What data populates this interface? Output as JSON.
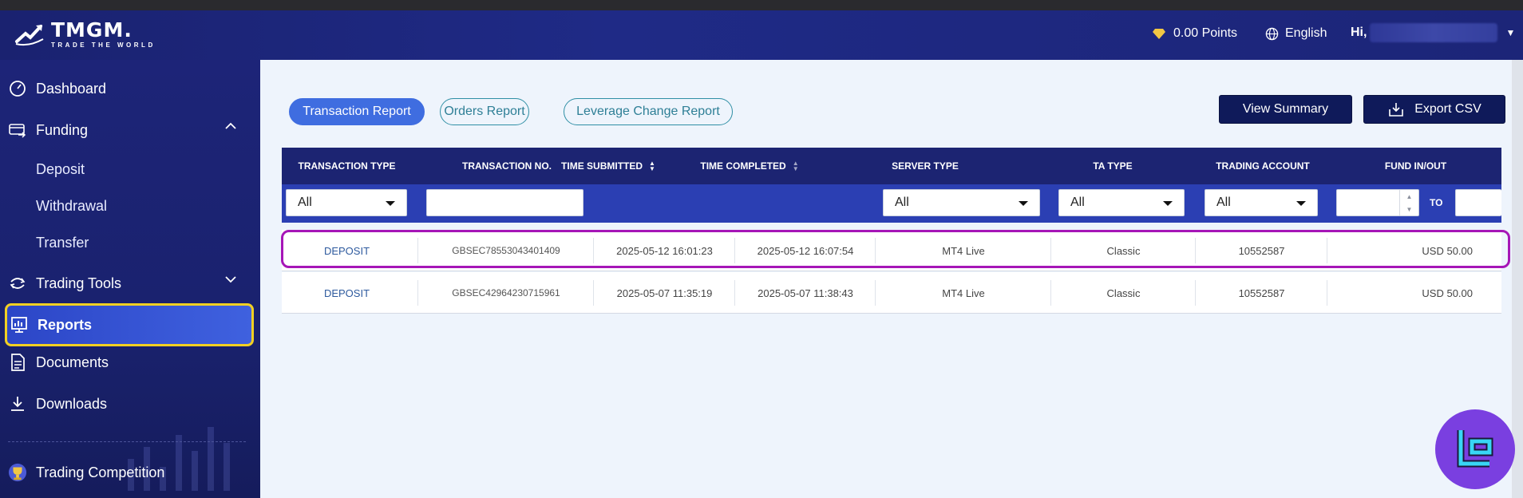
{
  "header": {
    "logo_name": "TMGM.",
    "logo_tagline": "TRADE THE WORLD",
    "points": "0.00 Points",
    "language": "English",
    "greeting": "Hi,"
  },
  "sidebar": {
    "items": [
      {
        "label": "Dashboard",
        "icon": "dashboard-icon"
      },
      {
        "label": "Funding",
        "icon": "funding-icon"
      },
      {
        "label": "Deposit"
      },
      {
        "label": "Withdrawal"
      },
      {
        "label": "Transfer"
      },
      {
        "label": "Trading Tools",
        "icon": "tools-icon"
      },
      {
        "label": "Reports",
        "icon": "reports-icon"
      },
      {
        "label": "Documents",
        "icon": "documents-icon"
      },
      {
        "label": "Downloads",
        "icon": "download-icon"
      },
      {
        "label": "Trading Competition",
        "icon": "trophy-icon"
      }
    ]
  },
  "tabs": [
    "Transaction Report",
    "Orders Report",
    "Leverage Change Report"
  ],
  "actions": {
    "view_summary": "View Summary",
    "export_csv": "Export CSV"
  },
  "table": {
    "headers": [
      "TRANSACTION TYPE",
      "TRANSACTION NO.",
      "TIME SUBMITTED",
      "TIME COMPLETED",
      "SERVER TYPE",
      "TA TYPE",
      "TRADING ACCOUNT",
      "FUND IN/OUT"
    ],
    "filters": {
      "transaction_type": "All",
      "server_type": "All",
      "ta_type": "All",
      "trading_account": "All",
      "to_label": "TO"
    },
    "rows": [
      [
        "DEPOSIT",
        "GBSEC78553043401409",
        "2025-05-12 16:01:23",
        "2025-05-12 16:07:54",
        "MT4 Live",
        "Classic",
        "10552587",
        "USD 50.00"
      ],
      [
        "DEPOSIT",
        "GBSEC42964230715961",
        "2025-05-07 11:35:19",
        "2025-05-07 11:38:43",
        "MT4 Live",
        "Classic",
        "10552587",
        "USD 50.00"
      ]
    ]
  },
  "colors": {
    "accent": "#3f6de0",
    "highlight_reports": "#f2d022",
    "highlight_row": "#a616b7",
    "nav_bg": "#1d2478"
  }
}
